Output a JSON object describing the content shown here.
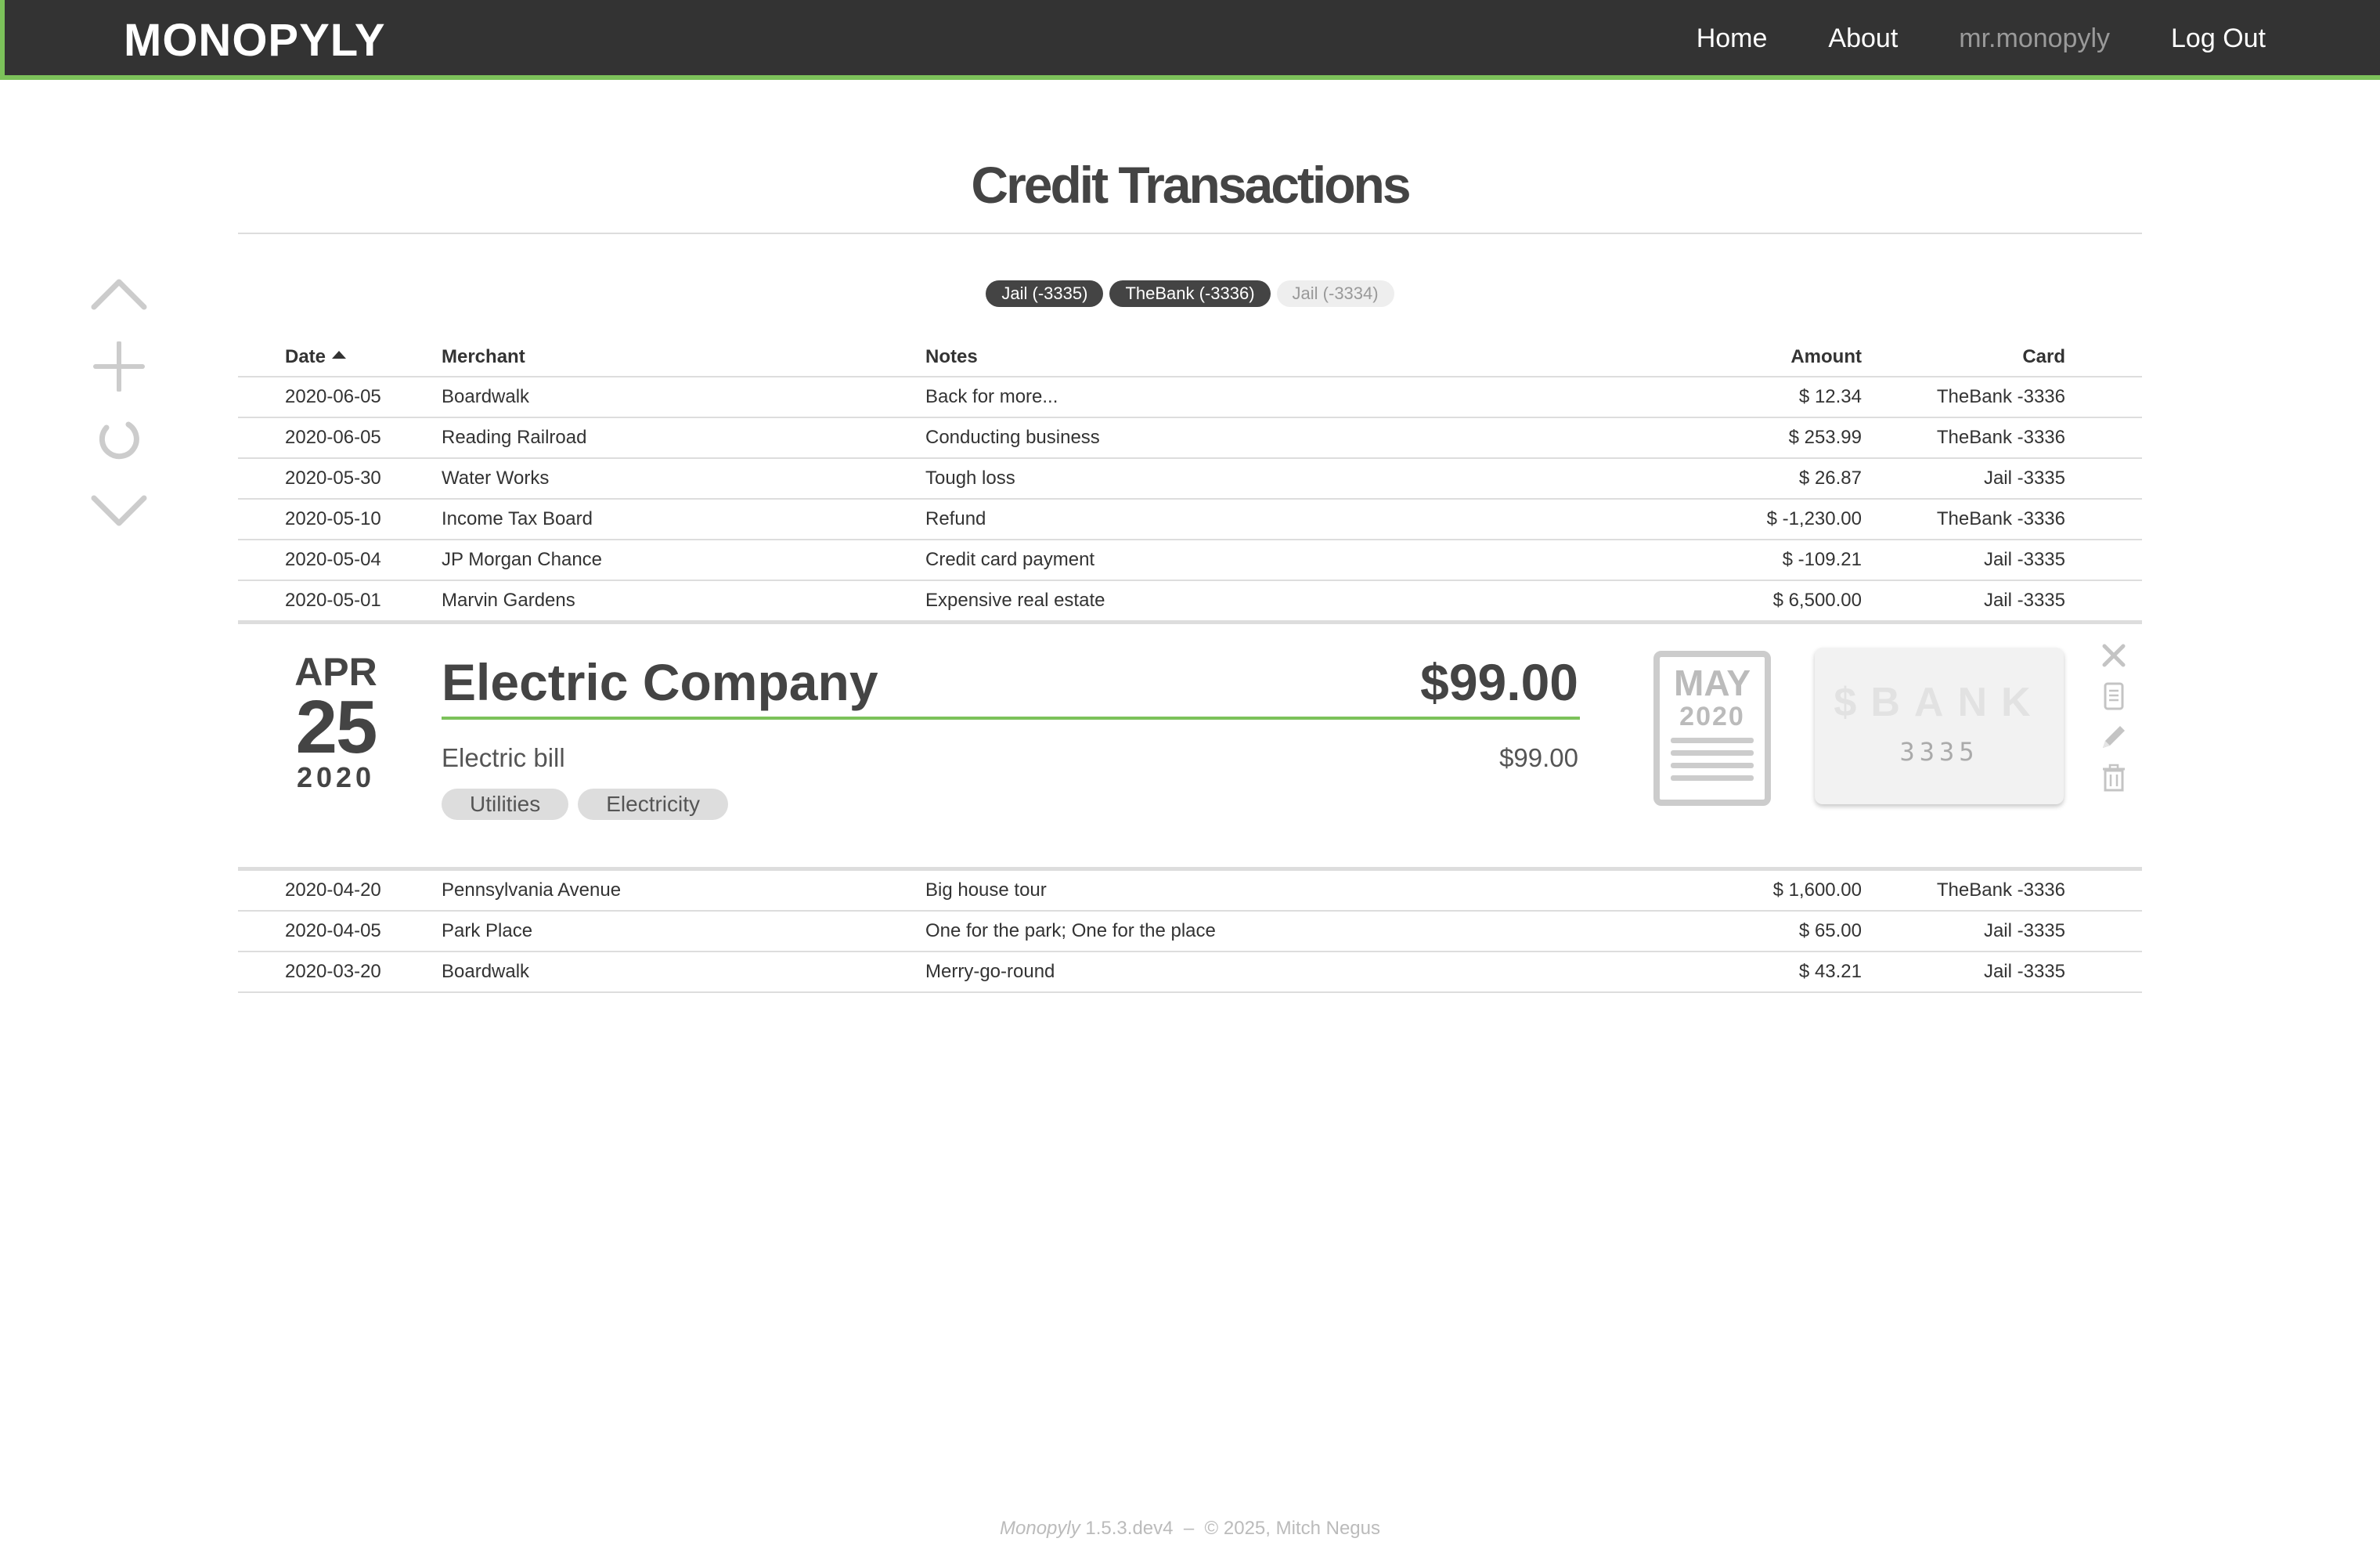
{
  "header": {
    "brand": "MONOPYLY",
    "nav": {
      "home": "Home",
      "about": "About",
      "user": "mr.monopyly",
      "logout": "Log Out"
    }
  },
  "page": {
    "title": "Credit Transactions"
  },
  "filters": [
    {
      "label": "Jail (-3335)",
      "active": true
    },
    {
      "label": "TheBank (-3336)",
      "active": true
    },
    {
      "label": "Jail (-3334)",
      "active": false
    }
  ],
  "table": {
    "headers": {
      "date": "Date",
      "merchant": "Merchant",
      "notes": "Notes",
      "amount": "Amount",
      "card": "Card"
    },
    "rows_top": [
      {
        "date": "2020-06-05",
        "merchant": "Boardwalk",
        "notes": "Back for more...",
        "amount": "$ 12.34",
        "card": "TheBank -3336"
      },
      {
        "date": "2020-06-05",
        "merchant": "Reading Railroad",
        "notes": "Conducting business",
        "amount": "$ 253.99",
        "card": "TheBank -3336"
      },
      {
        "date": "2020-05-30",
        "merchant": "Water Works",
        "notes": "Tough loss",
        "amount": "$ 26.87",
        "card": "Jail -3335"
      },
      {
        "date": "2020-05-10",
        "merchant": "Income Tax Board",
        "notes": "Refund",
        "amount": "$ -1,230.00",
        "card": "TheBank -3336"
      },
      {
        "date": "2020-05-04",
        "merchant": "JP Morgan Chance",
        "notes": "Credit card payment",
        "amount": "$ -109.21",
        "card": "Jail -3335"
      },
      {
        "date": "2020-05-01",
        "merchant": "Marvin Gardens",
        "notes": "Expensive real estate",
        "amount": "$ 6,500.00",
        "card": "Jail -3335"
      }
    ],
    "rows_bottom": [
      {
        "date": "2020-04-20",
        "merchant": "Pennsylvania Avenue",
        "notes": "Big house tour",
        "amount": "$ 1,600.00",
        "card": "TheBank -3336"
      },
      {
        "date": "2020-04-05",
        "merchant": "Park Place",
        "notes": "One for the park; One for the place",
        "amount": "$ 65.00",
        "card": "Jail -3335"
      },
      {
        "date": "2020-03-20",
        "merchant": "Boardwalk",
        "notes": "Merry-go-round",
        "amount": "$ 43.21",
        "card": "Jail -3335"
      }
    ]
  },
  "expanded": {
    "month": "APR",
    "day": "25",
    "year": "2020",
    "merchant": "Electric Company",
    "total": "$99.00",
    "note": "Electric bill",
    "subtotal": "$99.00",
    "tags": [
      "Utilities",
      "Electricity"
    ],
    "statement": {
      "month": "MAY",
      "year": "2020"
    },
    "card": {
      "bank": "$BANK",
      "digits": "3335"
    }
  },
  "footer": {
    "app": "Monopyly",
    "version": "1.5.3.dev4",
    "sep": "–",
    "copyright": "© 2025, Mitch Negus"
  },
  "icons": {
    "scroll_up": "chevron-up-icon",
    "add": "plus-icon",
    "refresh": "refresh-icon",
    "scroll_down": "chevron-down-icon",
    "close": "close-icon",
    "receipt": "receipt-icon",
    "edit": "pencil-icon",
    "delete": "trash-icon"
  },
  "colors": {
    "navbar": "#333333",
    "accent": "#7cc25a",
    "pill_active": "#444444"
  }
}
